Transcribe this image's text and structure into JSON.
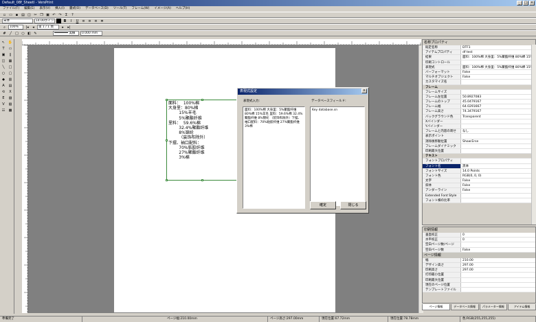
{
  "window": {
    "title": "Default_08f_Sheetl - VersPrint",
    "min": "_",
    "max": "□",
    "close": "×"
  },
  "menu": [
    "ファイル(F)",
    "編集(E)",
    "表示(V)",
    "挿入(I)",
    "書式(O)",
    "データベース(D)",
    "ツール(T)",
    "フレーム(W)",
    "イメージ(A)",
    "ヘルプ(H)"
  ],
  "toolbar": {
    "font": "宋体",
    "font_size": "14.00ポイント",
    "zoom": "100%",
    "page": "第 1 / 1 頁",
    "line_label": "実線",
    "line_width": "0.000 mm"
  },
  "frame_text": [
    "面料：  100%棉",
    "",
    "大身里：80%棉",
    "        15%羊毛",
    "        5%聚酯纤维",
    "",
    "里料：  59.6%棉",
    "        32.4%聚酯纤维",
    "        8%锦纶",
    "        （装饰布除外）",
    "",
    "下摆、袖口配料：",
    "        70%粘胶纤维",
    "        27%聚酯纤维",
    "        3%棉"
  ],
  "dialog": {
    "title": "表現式設定",
    "expr_label": "表現式入力:",
    "expr_text": "面料：100%棉 大身里：5%聚酯纤维 80%棉 15%羊毛 里料：59.6%棉 32.4%聚酯纤维 8%锦纶 （装饰布除外）下摆、袖口配料：70%粘胶纤维 27%聚酯纤维 3%棉",
    "db_label": "データベースフィールド:",
    "db_item": "Key database.sn",
    "ok": "確定",
    "close": "閉じる"
  },
  "props_title": "名称プロパティ",
  "props": [
    {
      "cat": false,
      "k": "既定名称",
      "v": "DTF1"
    },
    {
      "cat": false,
      "k": "アイテムプロパティ",
      "v": "df test"
    },
    {
      "cat": false,
      "k": "結果",
      "v": "面料：100%棉 大身里：5%聚酯纤维 80%棉 15%"
    },
    {
      "cat": false,
      "k": "印刷コントロール",
      "v": ""
    },
    {
      "cat": false,
      "k": "表現式",
      "v": "面料：100%棉 大身里：5%聚酯纤维 80%棉 15%"
    },
    {
      "cat": false,
      "k": "バーフォーマット",
      "v": "False"
    },
    {
      "cat": false,
      "k": "マルチオブジェクト",
      "v": "False"
    },
    {
      "cat": false,
      "k": "カスタマイズ名",
      "v": ""
    },
    {
      "cat": true,
      "k": "フレーム",
      "v": ""
    },
    {
      "cat": false,
      "k": "フレームサイズ",
      "v": ""
    },
    {
      "cat": false,
      "k": "フレーム左位置",
      "v": "50.8927083"
    },
    {
      "cat": false,
      "k": "フレームのトップ",
      "v": "45.0479167"
    },
    {
      "cat": false,
      "k": "フレーム幅",
      "v": "64.0291667"
    },
    {
      "cat": false,
      "k": "フレーム高さ",
      "v": "74.3479167"
    },
    {
      "cat": false,
      "k": "バックグラウンド色",
      "v": "Transparent"
    },
    {
      "cat": false,
      "k": "Xバインダー",
      "v": ""
    },
    {
      "cat": false,
      "k": "Yバインダー",
      "v": ""
    },
    {
      "cat": false,
      "k": "フレームと内容の寄せ",
      "v": "なし"
    },
    {
      "cat": false,
      "k": "表示ポイント",
      "v": ""
    },
    {
      "cat": false,
      "k": "消除後移動位置",
      "v": "Show:Erse"
    },
    {
      "cat": false,
      "k": "フレームダイナミック",
      "v": ""
    },
    {
      "cat": false,
      "k": "印刷最大位置",
      "v": ""
    },
    {
      "cat": true,
      "k": "テキスト",
      "v": ""
    },
    {
      "cat": false,
      "k": "フォントプロパティ",
      "v": ""
    },
    {
      "cat": false,
      "k": "フォント名",
      "v": "黑体",
      "sel": true
    },
    {
      "cat": false,
      "k": "フォントサイズ",
      "v": "14.0 Points"
    },
    {
      "cat": false,
      "k": "フォント色",
      "v": "RGB(0, 0, 0)"
    },
    {
      "cat": false,
      "k": "太字",
      "v": "False"
    },
    {
      "cat": false,
      "k": "斜体",
      "v": "False"
    },
    {
      "cat": false,
      "k": "アンダーライン",
      "v": "False"
    },
    {
      "cat": false,
      "k": "Extended Font Style",
      "v": ""
    },
    {
      "cat": false,
      "k": "フォント横の比率",
      "v": ""
    }
  ],
  "print_title": "印刷情報",
  "print_props": [
    {
      "k": "垂直校正",
      "v": "0"
    },
    {
      "k": "水平校正",
      "v": "0"
    },
    {
      "k": "空白ページ数/ページ",
      "v": ""
    },
    {
      "k": "空白ページ数",
      "v": "False"
    }
  ],
  "page_title": "ページ情報",
  "page_props": [
    {
      "k": "幅",
      "v": "210.00"
    },
    {
      "k": "デザイン高さ",
      "v": "297.00"
    },
    {
      "k": "印刷高さ",
      "v": "297.00"
    },
    {
      "k": "打印最小位置",
      "v": ""
    },
    {
      "k": "印刷最大位置",
      "v": ""
    },
    {
      "k": "現在のページ位置",
      "v": ""
    },
    {
      "k": "テンプレートファイル",
      "v": ""
    }
  ],
  "tabs": [
    "ページ情報",
    "データベース情報",
    "パラメーター情報",
    "アイテム情報"
  ],
  "status": [
    "準備完了",
    "ページ幅:210.00mm",
    "ページ高さ:297.00mm",
    "現在位置:67.72mm",
    "現在位置:78.78mm",
    "色:RGB(255,255,255)"
  ]
}
